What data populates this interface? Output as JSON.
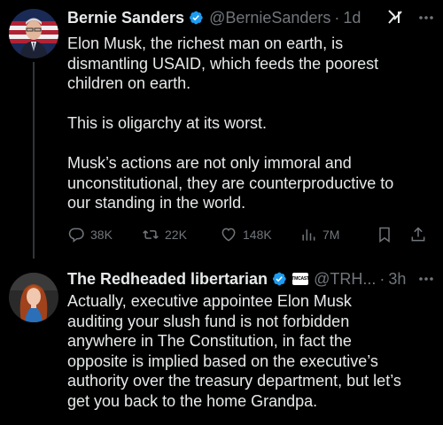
{
  "tweet1": {
    "display_name": "Bernie Sanders",
    "handle": "@BernieSanders",
    "separator": "·",
    "time": "1d",
    "body": "Elon Musk, the richest man on earth, is\ndismantling USAID, which feeds the poorest\nchildren on earth.\n\nThis is oligarchy at its worst.\n\nMusk’s actions are not only immoral and\nunconstitutional, they are counterproductive to\nour standing in the world.",
    "actions": {
      "replies": "38K",
      "retweets": "22K",
      "likes": "148K",
      "views": "7M"
    }
  },
  "tweet2": {
    "display_name": "The Redheaded libertarian",
    "badge_text": "TMCAST",
    "handle": "@TRH...",
    "separator": "·",
    "time": "3h",
    "body": "Actually, executive appointee Elon Musk\nauditing your slush fund is not forbidden\nanywhere in The Constitution, in fact the\nopposite is implied based on the executive’s\nauthority over the treasury department, but let’s\nget you back to the home Grandpa."
  },
  "colors": {
    "background": "#000000",
    "text_primary": "#e7e9ea",
    "text_secondary": "#71767b",
    "verified_blue": "#1d9bf0"
  },
  "icons": [
    "grok-icon",
    "more-icon",
    "verified-icon",
    "reply-icon",
    "retweet-icon",
    "like-icon",
    "views-icon",
    "bookmark-icon",
    "share-icon"
  ]
}
